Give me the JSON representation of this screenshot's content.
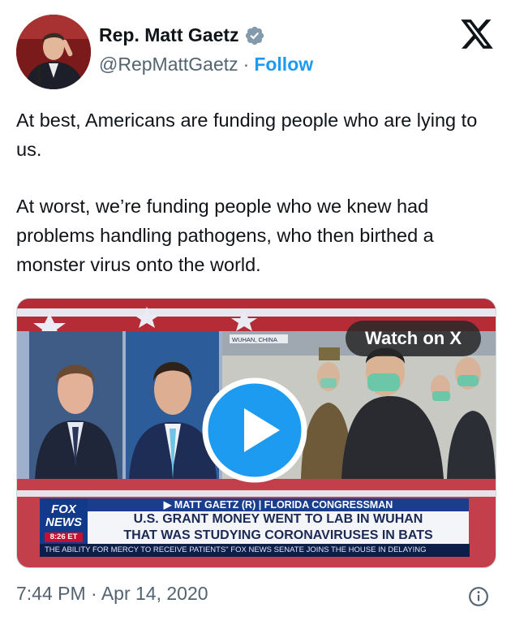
{
  "author": {
    "name": "Rep. Matt Gaetz",
    "handle": "@RepMattGaetz",
    "separator": "·",
    "follow_label": "Follow",
    "verified": true,
    "verified_color": "#1d9bf0"
  },
  "platform_logo": "x-logo-icon",
  "tweet": {
    "paragraph_1": "At best, Americans are funding people who are lying to us.",
    "paragraph_2": "At worst, we’re funding people who we knew had problems handling pathogens, who then birthed a monster virus onto the world."
  },
  "media": {
    "watch_label": "Watch on X",
    "play_icon": "play-icon",
    "video_frame": {
      "location_tag": "WUHAN, CHINA",
      "chyron_name": "▶ MATT GAETZ (R) | FLORIDA CONGRESSMAN",
      "chyron_line_1": "U.S. GRANT MONEY WENT TO LAB IN WUHAN",
      "chyron_line_2": "THAT WAS STUDYING CORONAVIRUSES IN BATS",
      "network_line_1": "FOX",
      "network_line_2": "NEWS",
      "network_time": "8:26 ET",
      "ticker": "THE ABILITY FOR MERCY TO RECEIVE PATIENTS\"   FOX NEWS   SENATE JOINS THE HOUSE IN DELAYING"
    }
  },
  "footer": {
    "timestamp": "7:44 PM · Apr 14, 2020",
    "info_icon": "info-icon"
  },
  "colors": {
    "accent": "#1d9bf0",
    "text": "#0f1419",
    "secondary_text": "#536471",
    "border": "#cfd9de"
  }
}
